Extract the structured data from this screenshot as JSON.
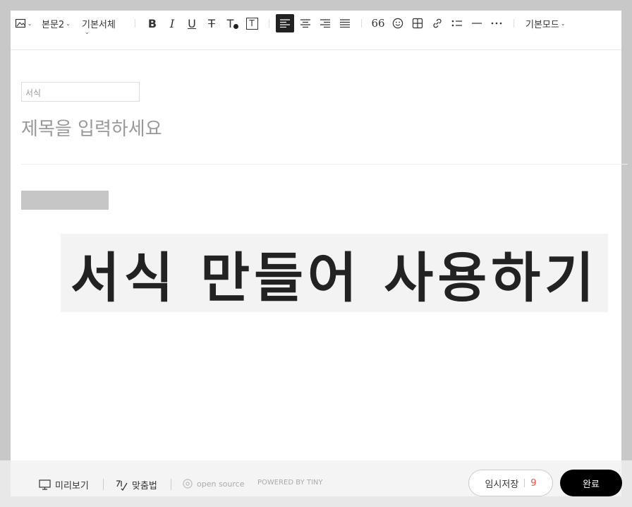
{
  "toolbar": {
    "image_icon": "image-icon",
    "paragraph_style": "본문2",
    "font_family": "기본서체",
    "bold": "B",
    "italic": "I",
    "underline": "U",
    "strikethrough": "T",
    "text_color": "T",
    "text_background": "T",
    "align_left_icon": "align-left-icon",
    "align_center_icon": "align-center-icon",
    "align_right_icon": "align-right-icon",
    "align_justify_icon": "align-justify-icon",
    "quote": "66",
    "mode": "기본모드"
  },
  "content": {
    "template_placeholder": "서식",
    "title_placeholder": "제목을 입력하세요",
    "heading": "서식 만들어 사용하기"
  },
  "footer": {
    "preview": "미리보기",
    "spellcheck": "맞춤법",
    "open_source": "open source",
    "powered_by": "POWERED BY TINY",
    "save_draft": "임시저장",
    "draft_count": "9",
    "done": "완료"
  },
  "colors": {
    "accent_count": "#e8533e",
    "done_button": "#000000",
    "active_tool": "#222222"
  }
}
